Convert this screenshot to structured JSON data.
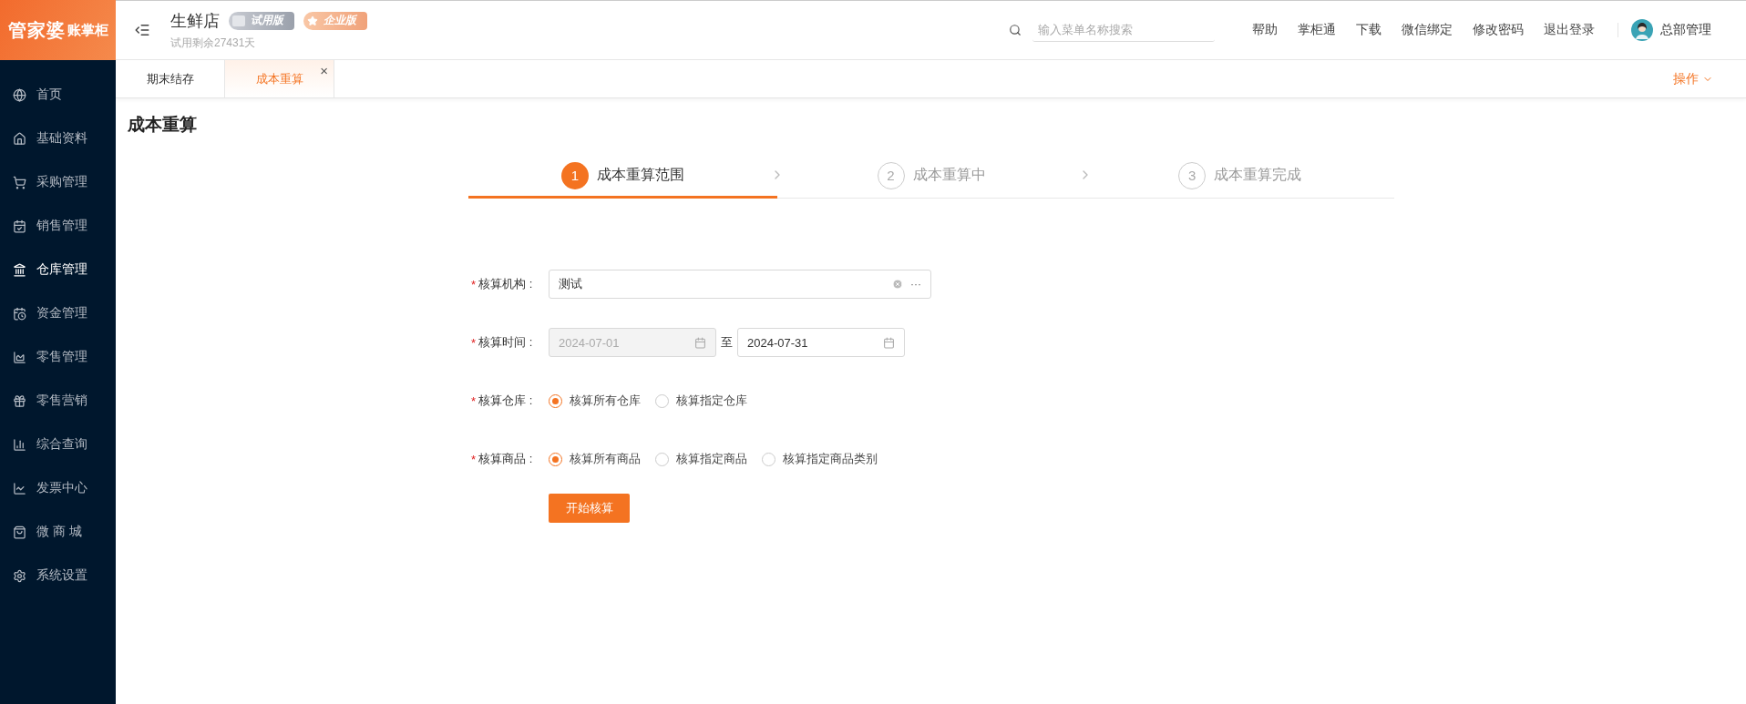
{
  "logo": {
    "brand": "管家婆",
    "product": "账掌柜"
  },
  "header": {
    "store": "生鲜店",
    "badges": [
      {
        "kind": "trial",
        "label": "试用版"
      },
      {
        "kind": "enterprise",
        "label": "企业版"
      }
    ],
    "trial_note": "试用剩余27431天",
    "search": {
      "placeholder": "输入菜单名称搜索"
    },
    "links": [
      "帮助",
      "掌柜通",
      "下载",
      "微信绑定",
      "修改密码",
      "退出登录"
    ],
    "user": "总部管理"
  },
  "sidebar": {
    "items": [
      {
        "label": "首页",
        "selected": false
      },
      {
        "label": "基础资料",
        "selected": false
      },
      {
        "label": "采购管理",
        "selected": false
      },
      {
        "label": "销售管理",
        "selected": false
      },
      {
        "label": "仓库管理",
        "selected": true
      },
      {
        "label": "资金管理",
        "selected": false
      },
      {
        "label": "零售管理",
        "selected": false
      },
      {
        "label": "零售营销",
        "selected": false
      },
      {
        "label": "综合查询",
        "selected": false
      },
      {
        "label": "发票中心",
        "selected": false
      },
      {
        "label": "微 商 城",
        "selected": false
      },
      {
        "label": "系统设置",
        "selected": false
      }
    ]
  },
  "tabs": [
    {
      "label": "期末结存",
      "selected": false
    },
    {
      "label": "成本重算",
      "selected": true,
      "close": "×"
    }
  ],
  "operations": "操作",
  "page_title": "成本重算",
  "steps": [
    {
      "number": "1",
      "label": "成本重算范围",
      "selected": true
    },
    {
      "number": "2",
      "label": "成本重算中",
      "selected": false
    },
    {
      "number": "3",
      "label": "成本重算完成",
      "selected": false
    }
  ],
  "form": [
    {
      "kind": "select",
      "mark": "*",
      "label": "核算机构 :",
      "value": "测试",
      "more": "···"
    },
    {
      "kind": "daterange",
      "mark": "*",
      "label": "核算时间 :",
      "start": {
        "value": "2024-07-01",
        "disabled": true
      },
      "separator": "至",
      "end": {
        "value": "2024-07-31",
        "disabled": false
      }
    },
    {
      "kind": "radio",
      "mark": "*",
      "label": "核算仓库 :",
      "options": [
        {
          "label": "核算所有仓库",
          "selected": true
        },
        {
          "label": "核算指定仓库",
          "selected": false
        }
      ]
    },
    {
      "kind": "radio",
      "mark": "*",
      "label": "核算商品 :",
      "options": [
        {
          "label": "核算所有商品",
          "selected": true
        },
        {
          "label": "核算指定商品",
          "selected": false
        },
        {
          "label": "核算指定商品类别",
          "selected": false
        }
      ]
    }
  ],
  "submit": "开始核算"
}
